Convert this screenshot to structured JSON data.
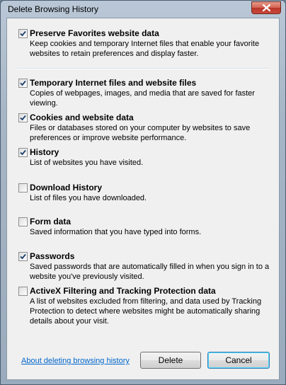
{
  "window": {
    "title": "Delete Browsing History"
  },
  "options": [
    {
      "title": "Preserve Favorites website data",
      "checked": true,
      "description": "Keep cookies and temporary Internet files that enable your favorite websites to retain preferences and display faster."
    },
    {
      "title": "Temporary Internet files and website files",
      "checked": true,
      "description": "Copies of webpages, images, and media that are saved for faster viewing."
    },
    {
      "title": "Cookies and website data",
      "checked": true,
      "description": "Files or databases stored on your computer by websites to save preferences or improve website performance."
    },
    {
      "title": "History",
      "checked": true,
      "description": "List of websites you have visited."
    },
    {
      "title": "Download History",
      "checked": false,
      "description": "List of files you have downloaded."
    },
    {
      "title": "Form data",
      "checked": false,
      "description": "Saved information that you have typed into forms."
    },
    {
      "title": "Passwords",
      "checked": true,
      "description": "Saved passwords that are automatically filled in when you sign in to a website you've previously visited."
    },
    {
      "title": "ActiveX Filtering and Tracking Protection data",
      "checked": false,
      "description": "A list of websites excluded from filtering, and data used by Tracking Protection to detect where websites might be automatically sharing details about your visit."
    }
  ],
  "footer": {
    "about_link": "About deleting browsing history",
    "delete_label": "Delete",
    "cancel_label": "Cancel"
  },
  "colors": {
    "link": "#0066cc",
    "close_button": "#c9473a"
  }
}
